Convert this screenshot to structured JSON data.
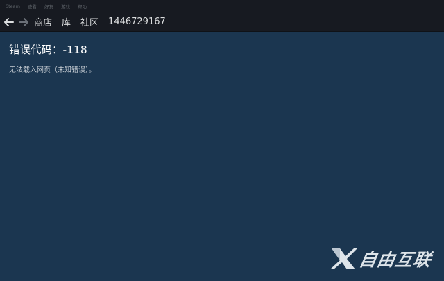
{
  "menubar": {
    "items": [
      {
        "label": "Steam"
      },
      {
        "label": "查看"
      },
      {
        "label": "好友"
      },
      {
        "label": "游戏"
      },
      {
        "label": "帮助"
      }
    ]
  },
  "navbar": {
    "back_icon": "back-arrow-icon",
    "forward_icon": "forward-arrow-icon",
    "links": [
      {
        "label": "商店"
      },
      {
        "label": "库"
      },
      {
        "label": "社区"
      },
      {
        "label": "1446729167"
      }
    ]
  },
  "content": {
    "error_title": "错误代码：-118",
    "error_message": "无法载入网页（未知错误）。"
  },
  "watermark": {
    "text": "自由互联",
    "logo_icon": "x-logo-icon"
  },
  "colors": {
    "background": "#1b3650",
    "menubar": "#171a21",
    "text": "#dcdedf"
  }
}
